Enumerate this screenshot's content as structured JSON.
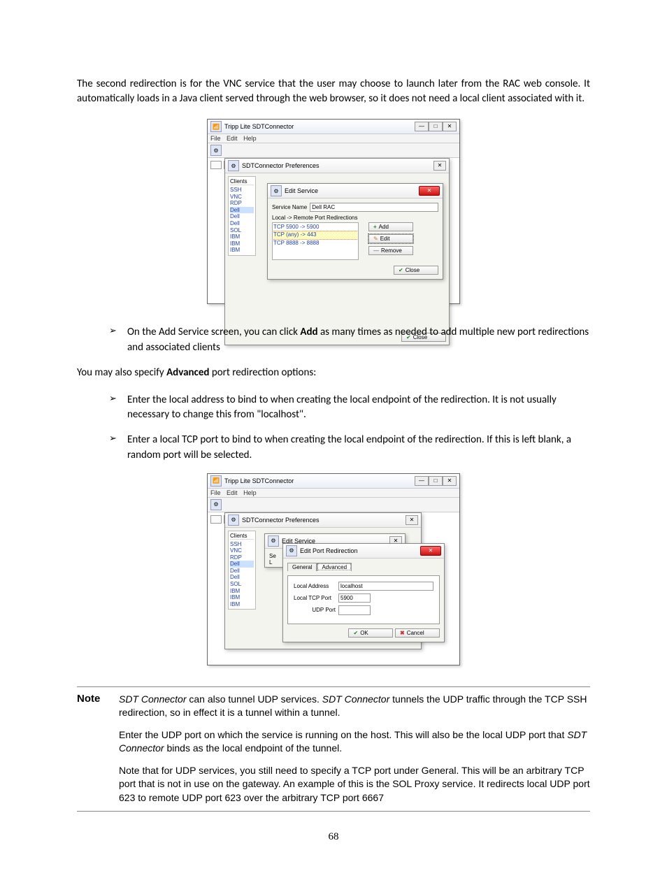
{
  "intro_paragraph": "The second redirection is for the VNC service that the user may choose to launch later from the RAC web console. It automatically loads in a Java client served through the web browser, so it does not need a local client associated with it.",
  "app_title": "Tripp Lite SDTConnector",
  "menus": {
    "file": "File",
    "edit": "Edit",
    "help": "Help"
  },
  "prefs_title": "SDTConnector Preferences",
  "edit_service_title": "Edit Service",
  "clients_header": "Clients",
  "services_list": [
    "SSH",
    "VNC",
    "RDP",
    "Dell",
    "Dell",
    "Dell",
    "SOL",
    "IBM",
    "IBM",
    "IBM"
  ],
  "service_name_label": "Service Name",
  "service_name_value": "Dell RAC",
  "redir_header": "Local -> Remote Port Redirections",
  "redir_items": [
    "TCP 5900 -> 5900",
    "TCP (any) -> 443",
    "TCP 8888 -> 8888"
  ],
  "btn_add": "Add",
  "btn_edit": "Edit",
  "btn_remove": "Remove",
  "btn_close": "Close",
  "btn_ok": "OK",
  "btn_cancel": "Cancel",
  "bullet1_pre": "On the Add Service screen, you can click ",
  "bullet1_bold": "Add",
  "bullet1_post": " as many times as needed to add multiple new port redirections and associated clients",
  "advanced_line_pre": "You may also specify ",
  "advanced_bold": "Advanced",
  "advanced_line_post": " port redirection options:",
  "bullet2": "Enter the local address to bind to when creating the local endpoint of the redirection. It is not usually necessary to change this from \"localhost\".",
  "bullet3": "Enter a local TCP port to bind to when creating the local endpoint of the redirection. If this is left blank, a random port will be selected.",
  "edit_port_redirection_title": "Edit Port Redirection",
  "tabs": {
    "general": "General",
    "advanced": "Advanced"
  },
  "adv_fields": {
    "local_address_label": "Local Address",
    "local_address_value": "localhost",
    "local_tcp_port_label": "Local TCP Port",
    "local_tcp_port_value": "5900",
    "udp_port_label": "UDP Port",
    "udp_port_value": ""
  },
  "note_label": "Note",
  "note_p1a": "SDT Connector",
  "note_p1b": " can also tunnel UDP services. ",
  "note_p1c": "SDT Connector",
  "note_p1d": " tunnels the UDP traffic through the TCP SSH redirection, so in effect it is a tunnel within a tunnel.",
  "note_p2a": "Enter the UDP port on which the service is running on the host. This will also be the local UDP port that ",
  "note_p2b": "SDT Connector",
  "note_p2c": " binds as the local endpoint of the tunnel.",
  "note_p3": "Note that for UDP services, you still need to specify a TCP port under General. This will be an arbitrary TCP port that is not in use on the gateway. An example of this is the SOL Proxy service. It redirects local UDP port 623 to remote UDP port 623 over the arbitrary TCP port 6667",
  "page_number": "68"
}
